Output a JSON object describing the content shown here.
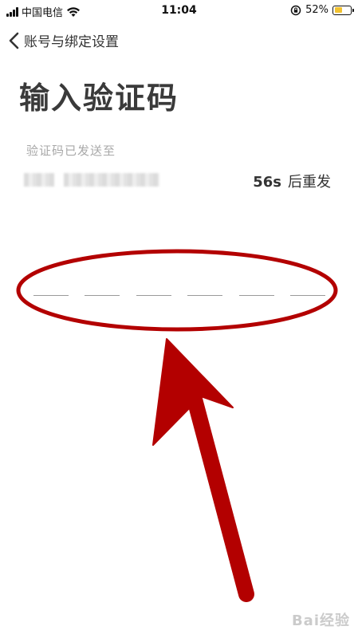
{
  "status_bar": {
    "carrier": "中国电信",
    "time": "11:04",
    "battery_percent": "52%",
    "battery_level": 0.52,
    "battery_color": "#f2c230"
  },
  "nav": {
    "back_icon": "chevron-left-icon",
    "back_label": "账号与绑定设置"
  },
  "page": {
    "title": "输入验证码",
    "sent_to_label": "验证码已发送至",
    "countdown": "56s",
    "resend_label": "后重发"
  },
  "code_input": {
    "length": 6
  },
  "annotation": {
    "color": "#b30000"
  },
  "watermark": {
    "text": "Bai经验"
  }
}
